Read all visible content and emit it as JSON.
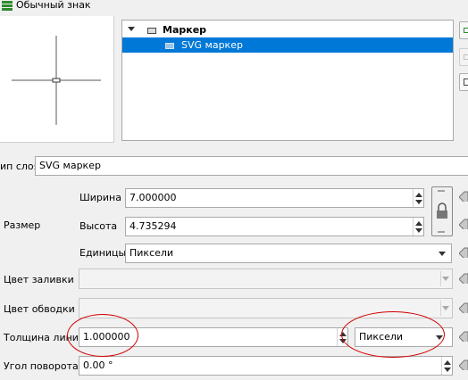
{
  "window": {
    "title": "Обычный знак"
  },
  "tree": {
    "items": [
      {
        "label": "Маркер",
        "level": 0,
        "selected": false
      },
      {
        "label": "SVG маркер",
        "level": 1,
        "selected": true
      }
    ]
  },
  "layer_type": {
    "label": "ип слоя",
    "value": "SVG маркер"
  },
  "size": {
    "group_label": "Размер",
    "width_label": "Ширина",
    "width_value": "7.000000",
    "height_label": "Высота",
    "height_value": "4.735294",
    "units_label": "Единицы",
    "units_value": "Пиксели"
  },
  "fill_color": {
    "label": "Цвет заливки",
    "value": ""
  },
  "stroke_color": {
    "label": "Цвет обводки",
    "value": ""
  },
  "stroke_width": {
    "label": "Толщина линий",
    "value": "1.000000",
    "units_value": "Пиксели"
  },
  "rotation": {
    "label": "Угол поворота",
    "value": "0.00 °"
  },
  "colors": {
    "selection": "#0078d7",
    "annotation": "#d10000"
  }
}
